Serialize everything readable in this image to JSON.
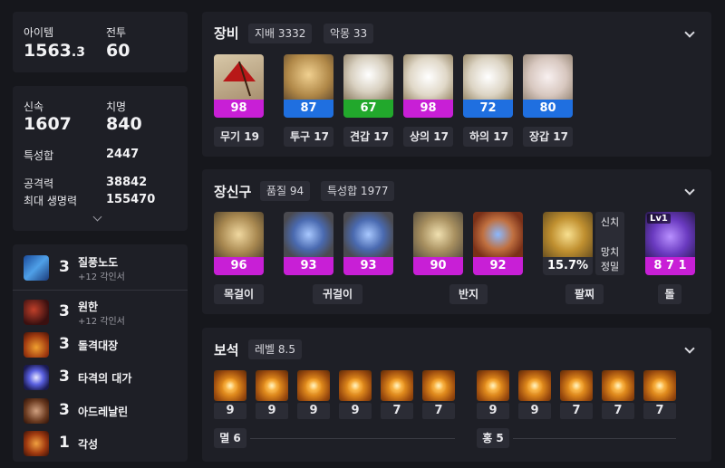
{
  "summary": {
    "item_level_label": "아이템",
    "item_level_value": "1563",
    "item_level_decimal": ".3",
    "combat_label": "전투",
    "combat_value": "60"
  },
  "stats": {
    "swiftness_label": "신속",
    "swiftness_value": "1607",
    "crit_label": "치명",
    "crit_value": "840",
    "total_label": "특성합",
    "total_value": "2447",
    "attack_label": "공격력",
    "attack_value": "38842",
    "hp_label": "최대 생명력",
    "hp_value": "155470"
  },
  "engravings": [
    {
      "level": "3",
      "name": "질풍노도",
      "sub": "+12 각인서",
      "icon": "wind-icon"
    },
    {
      "level": "3",
      "name": "원한",
      "sub": "+12 각인서",
      "icon": "grudge-icon"
    },
    {
      "level": "3",
      "name": "돌격대장",
      "sub": "",
      "icon": "raid-captain-icon"
    },
    {
      "level": "3",
      "name": "타격의 대가",
      "sub": "",
      "icon": "hit-master-icon"
    },
    {
      "level": "3",
      "name": "아드레날린",
      "sub": "",
      "icon": "adrenaline-icon"
    },
    {
      "level": "1",
      "name": "각성",
      "sub": "",
      "icon": "awakening-icon"
    }
  ],
  "equipment": {
    "title": "장비",
    "badge1": "지배 3332",
    "badge2": "악몽 33",
    "items": [
      {
        "label": "무기 19",
        "quality": "98",
        "bar_color": "#c81fd6",
        "icon": "parasol-weapon-icon"
      },
      {
        "label": "투구 17",
        "quality": "87",
        "bar_color": "#1f6fe0",
        "icon": "helmet-icon"
      },
      {
        "label": "견갑 17",
        "quality": "67",
        "bar_color": "#22a82c",
        "icon": "shoulder-icon"
      },
      {
        "label": "상의 17",
        "quality": "98",
        "bar_color": "#c81fd6",
        "icon": "top-armor-icon"
      },
      {
        "label": "하의 17",
        "quality": "72",
        "bar_color": "#1f6fe0",
        "icon": "pants-icon"
      },
      {
        "label": "장갑 17",
        "quality": "80",
        "bar_color": "#1f6fe0",
        "icon": "gloves-icon"
      }
    ]
  },
  "accessories": {
    "title": "장신구",
    "badge1": "품질 94",
    "badge2": "특성합 1977",
    "items": [
      {
        "quality": "96",
        "icon": "necklace-icon"
      },
      {
        "quality": "93",
        "icon": "earring-icon"
      },
      {
        "quality": "93",
        "icon": "earring-icon"
      },
      {
        "quality": "90",
        "icon": "ring-icon"
      },
      {
        "quality": "92",
        "icon": "ring-icon"
      }
    ],
    "bracelet": {
      "value": "15.7%",
      "tags": [
        "신치",
        "망치",
        "정밀"
      ],
      "icon": "bracelet-icon"
    },
    "stone": {
      "level": "Lv1",
      "value": "8 7 1",
      "icon": "ability-stone-icon"
    },
    "labels": {
      "necklace": "목걸이",
      "earring": "귀걸이",
      "ring": "반지",
      "bracelet": "팔찌",
      "stone": "돌"
    }
  },
  "gems": {
    "title": "보석",
    "badge": "레벨 8.5",
    "left_values": [
      "9",
      "9",
      "9",
      "9",
      "7",
      "7"
    ],
    "right_values": [
      "9",
      "9",
      "7",
      "7",
      "7"
    ],
    "left_label": "멸 6",
    "right_label": "홍 5",
    "icon": "gem-icon"
  }
}
